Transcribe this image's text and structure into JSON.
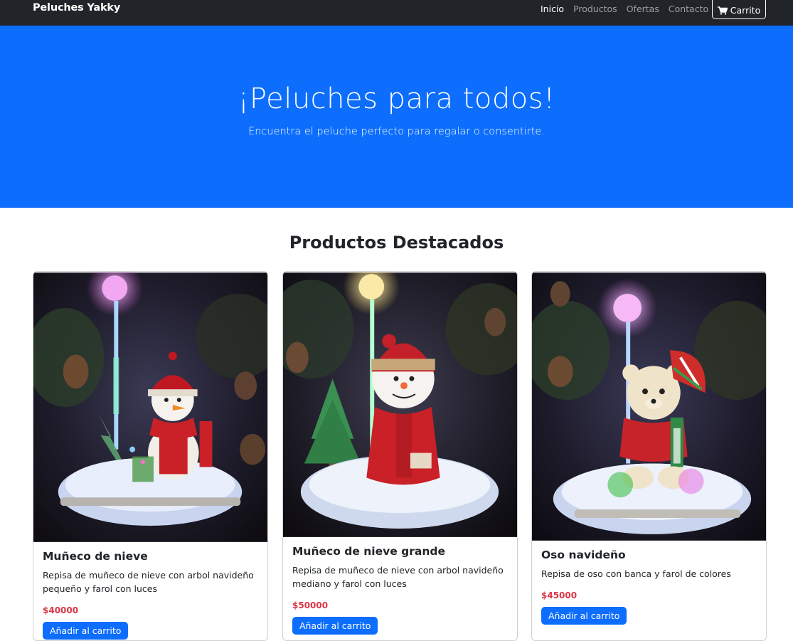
{
  "navbar": {
    "brand": "Peluches Yakky",
    "links": [
      "Inicio",
      "Productos",
      "Ofertas",
      "Contacto"
    ],
    "cart_label": "Carrito",
    "cart_icon": "shopping-cart-icon"
  },
  "hero": {
    "title": "¡Peluches para todos!",
    "subtitle": "Encuentra el peluche perfecto para regalar o consentirte."
  },
  "featured": {
    "title": "Productos Destacados",
    "products": [
      {
        "name": "Muñeco de nieve",
        "description": "Repisa de muñeco de nieve con arbol navideño pequeño y farol con luces",
        "price": "$40000",
        "button": "Añadir al carrito"
      },
      {
        "name": "Muñeco de nieve grande",
        "description": "Repisa de muñeco de nieve con arbol navideño mediano y farol con luces",
        "price": "$50000",
        "button": "Añadir al carrito"
      },
      {
        "name": "Oso navideño",
        "description": "Repisa de oso con banca y farol de colores",
        "price": "$45000",
        "button": "Añadir al carrito"
      }
    ]
  },
  "colors": {
    "navbar_bg": "#212529",
    "hero_bg": "#0d6efd",
    "price": "#dc3545",
    "button": "#0d6efd"
  }
}
